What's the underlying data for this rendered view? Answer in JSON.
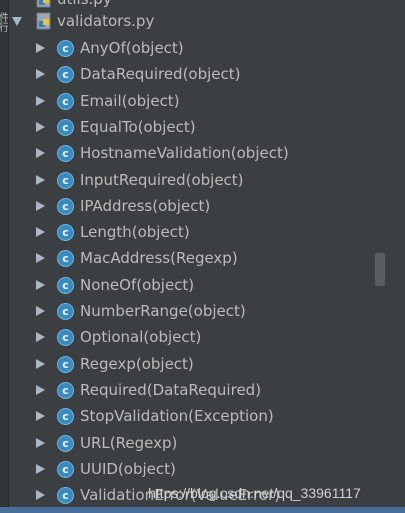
{
  "left_strip": {
    "glyphs": [
      "件",
      "行"
    ]
  },
  "tree": {
    "top_file": "utils.py",
    "module": "validators.py",
    "class_icon_letter": "c",
    "classes": [
      "AnyOf(object)",
      "DataRequired(object)",
      "Email(object)",
      "EqualTo(object)",
      "HostnameValidation(object)",
      "InputRequired(object)",
      "IPAddress(object)",
      "Length(object)",
      "MacAddress(Regexp)",
      "NoneOf(object)",
      "NumberRange(object)",
      "Optional(object)",
      "Regexp(object)",
      "Required(DataRequired)",
      "StopValidation(Exception)",
      "URL(Regexp)",
      "UUID(object)",
      "ValidationError(ValueError)"
    ]
  },
  "watermark": "https://blog.csdn.net/qq_33961117",
  "colors": {
    "background": "#3c3f41",
    "text": "#bbbbbb",
    "class_icon": "#3a8abf",
    "selection_bar": "#4a6f9c"
  }
}
